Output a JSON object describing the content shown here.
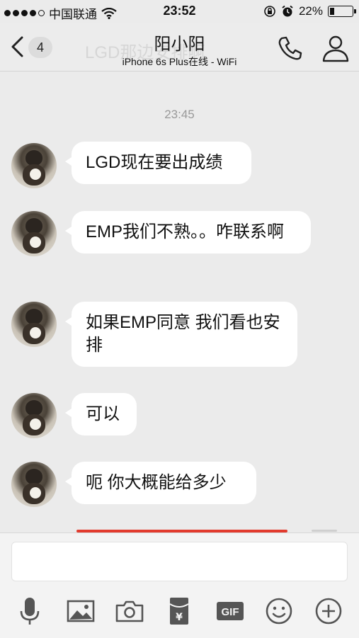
{
  "status_bar": {
    "carrier": "中国联通",
    "time": "23:52",
    "battery_percent": "22%",
    "battery_level": 0.22
  },
  "nav": {
    "unread_count": "4",
    "ghost_text": "LGD那边安排啊",
    "title": "阳小阳",
    "subtitle": "iPhone 6s Plus在线 - WiFi"
  },
  "chat": {
    "timestamp": "23:45",
    "messages": [
      {
        "text": "LGD现在要出成绩"
      },
      {
        "text": "EMP我们不熟。。咋联系啊"
      },
      {
        "text": "如果EMP同意 我们看也安排"
      },
      {
        "text": "可以"
      },
      {
        "text": "呃 你大概能给多少"
      }
    ]
  },
  "input": {
    "value": ""
  },
  "toolbar": {
    "icons": [
      "microphone-icon",
      "image-icon",
      "camera-icon",
      "red-packet-icon",
      "gif-icon",
      "emoji-icon",
      "plus-icon"
    ],
    "gif_label": "GIF",
    "redpacket_label": "¥"
  },
  "colors": {
    "background": "#ebebeb",
    "bubble": "#ffffff",
    "red_packet": "#e23b2e"
  }
}
